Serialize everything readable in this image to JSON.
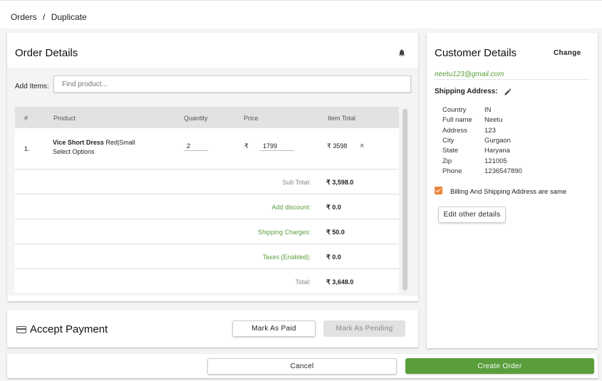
{
  "breadcrumb": {
    "parent": "Orders",
    "separator": "/",
    "current": "Duplicate"
  },
  "order_details": {
    "title": "Order Details",
    "add_items_label": "Add Items:",
    "search_placeholder": "Find product...",
    "columns": [
      "#",
      "Product",
      "Quantity",
      "Price",
      "Item Total"
    ],
    "items": [
      {
        "index": "1.",
        "name": "Vice Short Dress",
        "variant": "Red|Small",
        "options_link": "Select Options",
        "quantity": "2",
        "currency": "₹",
        "price": "1799",
        "item_total": "₹ 3598",
        "remove": "×"
      }
    ],
    "summary": [
      {
        "label": "Sub Total:",
        "value": "₹ 3,598.0",
        "style": "grey"
      },
      {
        "label": "Add discount:",
        "value": "₹ 0.0",
        "style": "green"
      },
      {
        "label": "Shipping Charges:",
        "value": "₹ 50.0",
        "style": "green"
      },
      {
        "label": "Taxes (Enabled):",
        "value": "₹ 0.0",
        "style": "green"
      },
      {
        "label": "Total:",
        "value": "₹ 3,648.0",
        "style": "grey"
      }
    ]
  },
  "payment": {
    "title": "Accept Payment",
    "mark_paid_label": "Mark As Paid",
    "mark_pending_label": "Mark As Pending"
  },
  "customer": {
    "title": "Customer Details",
    "change_label": "Change",
    "email": "neetu123@gmail.com",
    "shipping_label": "Shipping Address:",
    "address": [
      {
        "key": "Country",
        "value": "IN"
      },
      {
        "key": "Full name",
        "value": "Neetu"
      },
      {
        "key": "Address",
        "value": "123"
      },
      {
        "key": "City",
        "value": "Gurgaon"
      },
      {
        "key": "State",
        "value": "Haryana"
      },
      {
        "key": "Zip",
        "value": "121005"
      },
      {
        "key": "Phone",
        "value": "1236547890"
      }
    ],
    "billing_same_label": "Billing And Shipping Address are same",
    "edit_other_label": "Edit other details"
  },
  "actions": {
    "cancel_label": "Cancel",
    "create_label": "Create Order"
  },
  "colors": {
    "accent_green": "#5a9e3c",
    "checkbox_orange": "#e8833a"
  },
  "icons": {
    "bell": "bell-icon",
    "pencil": "pencil-icon",
    "card": "credit-card-icon",
    "close": "close-icon"
  }
}
